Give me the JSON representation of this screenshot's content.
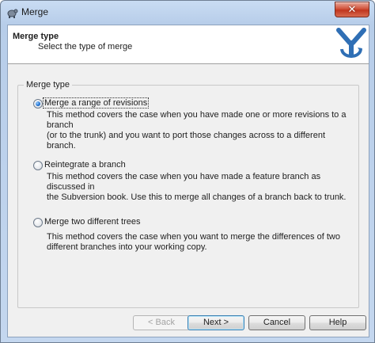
{
  "window": {
    "title": "Merge"
  },
  "header": {
    "title": "Merge type",
    "subtitle": "Select the type of merge"
  },
  "group": {
    "legend": "Merge type"
  },
  "options": [
    {
      "label": "Merge a range of revisions",
      "checked": true,
      "description_lines": [
        "This method covers the case when you have made one or more revisions to a branch",
        "(or to the trunk) and you want to port those changes across to a different branch."
      ]
    },
    {
      "label": "Reintegrate a branch",
      "checked": false,
      "description_lines": [
        "This method covers the case when you have made a feature branch as discussed in",
        "the Subversion book. Use this to merge all changes of a branch back to trunk."
      ]
    },
    {
      "label": "Merge two different trees",
      "checked": false,
      "description_lines": [
        "This method covers the case when you want to merge the differences of two",
        "different branches into your working copy."
      ]
    }
  ],
  "buttons": {
    "back": "< Back",
    "next": "Next >",
    "cancel": "Cancel",
    "help": "Help"
  },
  "icons": {
    "app": "tortoisesvn-icon",
    "header": "merge-icon",
    "close": "close-icon"
  },
  "colors": {
    "title_bar": "#b7cde9",
    "close": "#c0361e",
    "accent": "#1c6fd0"
  }
}
